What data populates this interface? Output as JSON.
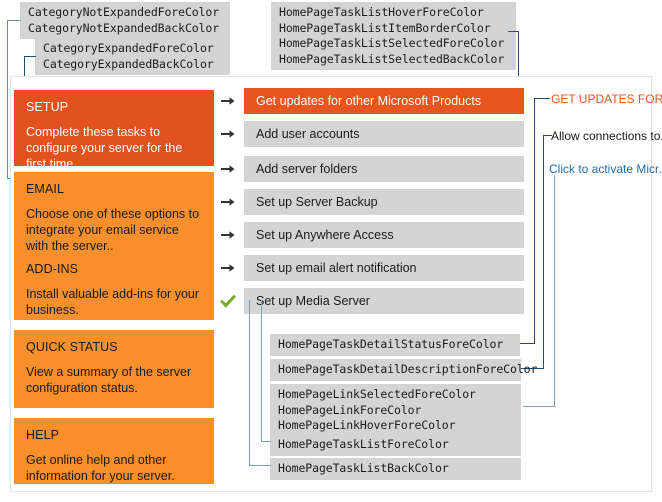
{
  "callouts": {
    "top_left_1": "CategoryNotExpandedForeColor\nCategoryNotExpandedBackColor",
    "top_left_2": "CategoryExpandedForeColor\nCategoryExpandedBackColor",
    "top_right": "HomePageTaskListHoverForeColor\nHomePageTaskListItemBorderColor\nHomePageTaskListSelectedForeColor\nHomePageTaskListSelectedBackColor",
    "bottom_1": "HomePageTaskDetailStatusForeColor",
    "bottom_2": "HomePageTaskDetailDescriptionForeColor",
    "bottom_3": "HomePageLinkSelectedForeColor\nHomePageLinkForeColor\nHomePageLinkHoverForeColor",
    "bottom_4": "HomePageTaskListForeColor",
    "bottom_5": "HomePageTaskListBackColor"
  },
  "sidebar": {
    "categories": [
      {
        "title": "SETUP",
        "description": "Complete these tasks to configure your server for the first time.",
        "state": "expanded",
        "back_color": "#e2511e",
        "fore_color": "#ffffff"
      },
      {
        "title": "EMAIL",
        "description": "Choose one of these options to integrate your email service with the server..",
        "state": "collapsed",
        "back_color": "#f98f2b",
        "fore_color": "#1a1a1a"
      },
      {
        "title": "ADD-INS",
        "description": "Install valuable add-ins for your business.",
        "state": "collapsed",
        "back_color": "#f98f2b",
        "fore_color": "#1a1a1a"
      },
      {
        "title": "QUICK STATUS",
        "description": "View a summary of the server configuration status.",
        "state": "collapsed",
        "back_color": "#f98f2b",
        "fore_color": "#1a1a1a"
      },
      {
        "title": "HELP",
        "description": "Get online help and other information for your server.",
        "state": "collapsed",
        "back_color": "#f98f2b",
        "fore_color": "#1a1a1a"
      }
    ]
  },
  "task_list": {
    "back_color": "#d4d4d4",
    "selected_back_color": "#e8551e",
    "selected_fore_color": "#ffffff",
    "fore_color": "#1a1a1a",
    "items": [
      {
        "label": "Get updates for other Microsoft Products",
        "icon": "arrow-right-icon",
        "selected": true
      },
      {
        "label": "Add user accounts",
        "icon": "arrow-right-icon",
        "selected": false
      },
      {
        "label": "Add server folders",
        "icon": "arrow-right-icon",
        "selected": false
      },
      {
        "label": "Set up Server Backup",
        "icon": "arrow-right-icon",
        "selected": false
      },
      {
        "label": "Set up Anywhere Access",
        "icon": "arrow-right-icon",
        "selected": false
      },
      {
        "label": "Set up email alert notification",
        "icon": "arrow-right-icon",
        "selected": false
      },
      {
        "label": "Set up Media Server",
        "icon": "check-icon",
        "selected": false
      }
    ]
  },
  "detail_labels": [
    {
      "text": "GET UPDATES FOR O...",
      "color": "#e8551e"
    },
    {
      "text": "Allow connections to...",
      "color": "#1a1a1a"
    },
    {
      "text": "Click to activate Micr...",
      "color": "#1f6fb4"
    }
  ]
}
